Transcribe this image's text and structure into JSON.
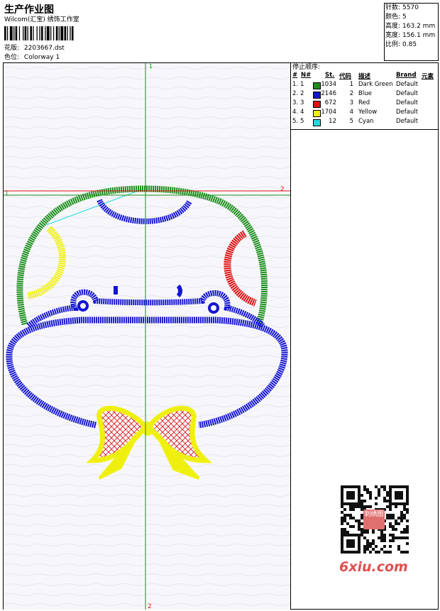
{
  "header": {
    "title": "生产作业图",
    "company": "Wilcom(汇宝) 绣饰工作室",
    "design_label": "花版:",
    "design_value": "2203667.dst",
    "colorway_label": "色位:",
    "colorway_value": "Colorway 1"
  },
  "stats": [
    {
      "label": "针数:",
      "value": "5570"
    },
    {
      "label": "颜色:",
      "value": "5"
    },
    {
      "label": "高度:",
      "value": "163.2 mm"
    },
    {
      "label": "宽度:",
      "value": "156.1 mm"
    },
    {
      "label": "比例:",
      "value": "0.85"
    }
  ],
  "stop_table": {
    "title": "停止顺序:",
    "headers": [
      "#",
      "N#",
      "St.",
      "代码",
      "描述",
      "Brand",
      "元素"
    ],
    "rows": [
      {
        "idx": "1.",
        "n": "1",
        "color": "#1a8f1a",
        "st": "1034",
        "code": "1",
        "desc": "Dark Green",
        "brand": "Default"
      },
      {
        "idx": "2.",
        "n": "2",
        "color": "#1414d2",
        "st": "2146",
        "code": "2",
        "desc": "Blue",
        "brand": "Default"
      },
      {
        "idx": "3.",
        "n": "3",
        "color": "#e01010",
        "st": "672",
        "code": "3",
        "desc": "Red",
        "brand": "Default"
      },
      {
        "idx": "4.",
        "n": "4",
        "color": "#f0f010",
        "st": "1704",
        "code": "4",
        "desc": "Yellow",
        "brand": "Default"
      },
      {
        "idx": "5.",
        "n": "5",
        "color": "#20d8e0",
        "st": "12",
        "code": "5",
        "desc": "Cyan",
        "brand": "Default"
      }
    ]
  },
  "guides": {
    "v_top": "1",
    "v_bottom": "2",
    "h_left": "1",
    "h_right": "2"
  },
  "watermark": {
    "text": "6xiu.com",
    "seal_text": "刺绣图"
  },
  "colors": {
    "green": "#1a8f1a",
    "blue": "#1414d2",
    "red": "#e01010",
    "yellow": "#f0f010",
    "cyan": "#20d8e0",
    "guide_v": "#1a8f1a",
    "guide_h": "#e01010",
    "watermark": "#e05050"
  }
}
